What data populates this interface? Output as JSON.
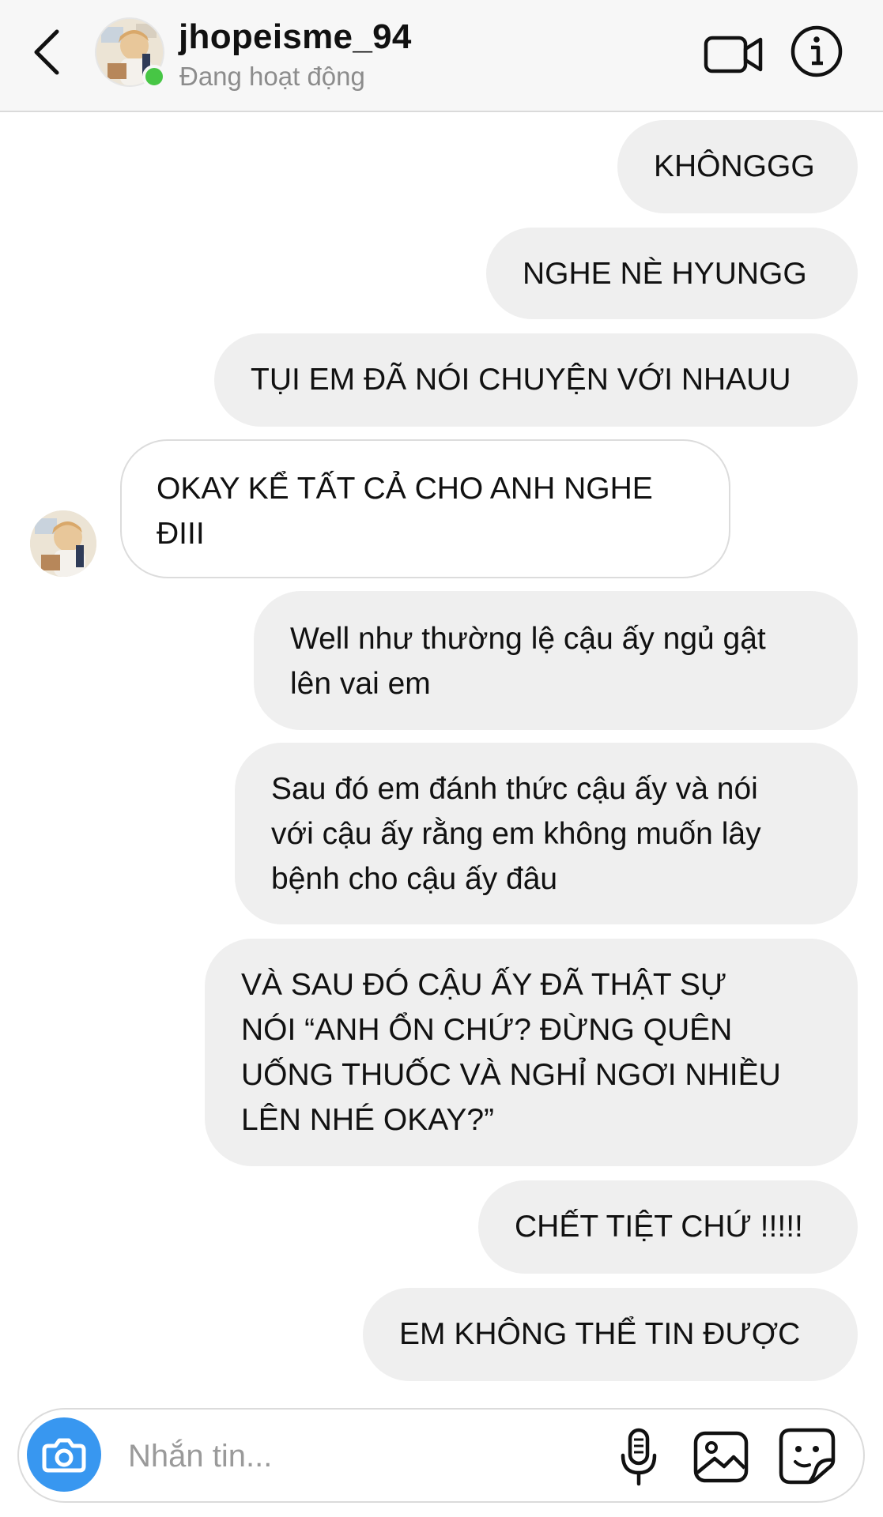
{
  "header": {
    "username": "jhopeisme_94",
    "status": "Đang hoạt động"
  },
  "messages": [
    {
      "sender": "me",
      "text": "KHÔNGGG"
    },
    {
      "sender": "me",
      "text": "NGHE NÈ HYUNGG"
    },
    {
      "sender": "me",
      "text": "TỤI EM ĐÃ NÓI CHUYỆN VỚI NHAUU"
    },
    {
      "sender": "them",
      "text": "OKAY KỂ TẤT CẢ CHO ANH NGHE\nĐIII"
    },
    {
      "sender": "me",
      "text": "Well như thường lệ cậu ấy ngủ gật\nlên vai em"
    },
    {
      "sender": "me",
      "text": "Sau đó em đánh thức cậu ấy và nói\nvới cậu ấy rằng em không muốn lây\nbệnh cho cậu ấy đâu"
    },
    {
      "sender": "me",
      "text": "VÀ SAU ĐÓ CẬU ẤY ĐÃ THẬT SỰ\nNÓI “ANH ỔN CHỨ? ĐỪNG QUÊN\nUỐNG THUỐC VÀ NGHỈ NGƠI NHIỀU\nLÊN NHÉ OKAY?”"
    },
    {
      "sender": "me",
      "text": "CHẾT TIỆT CHỨ !!!!!"
    },
    {
      "sender": "me",
      "text": "EM KHÔNG THỂ TIN ĐƯỢC"
    }
  ],
  "composer": {
    "placeholder": "Nhắn tin..."
  },
  "icons": {
    "back": "chevron-left-icon",
    "video": "video-camera-icon",
    "info": "info-icon",
    "camera": "camera-icon",
    "mic": "microphone-icon",
    "gallery": "image-icon",
    "sticker": "sticker-icon"
  },
  "colors": {
    "online": "#47c645",
    "camera_button": "#3897f0",
    "outgoing_bubble": "#efefef",
    "incoming_border": "#dcdcdc"
  }
}
